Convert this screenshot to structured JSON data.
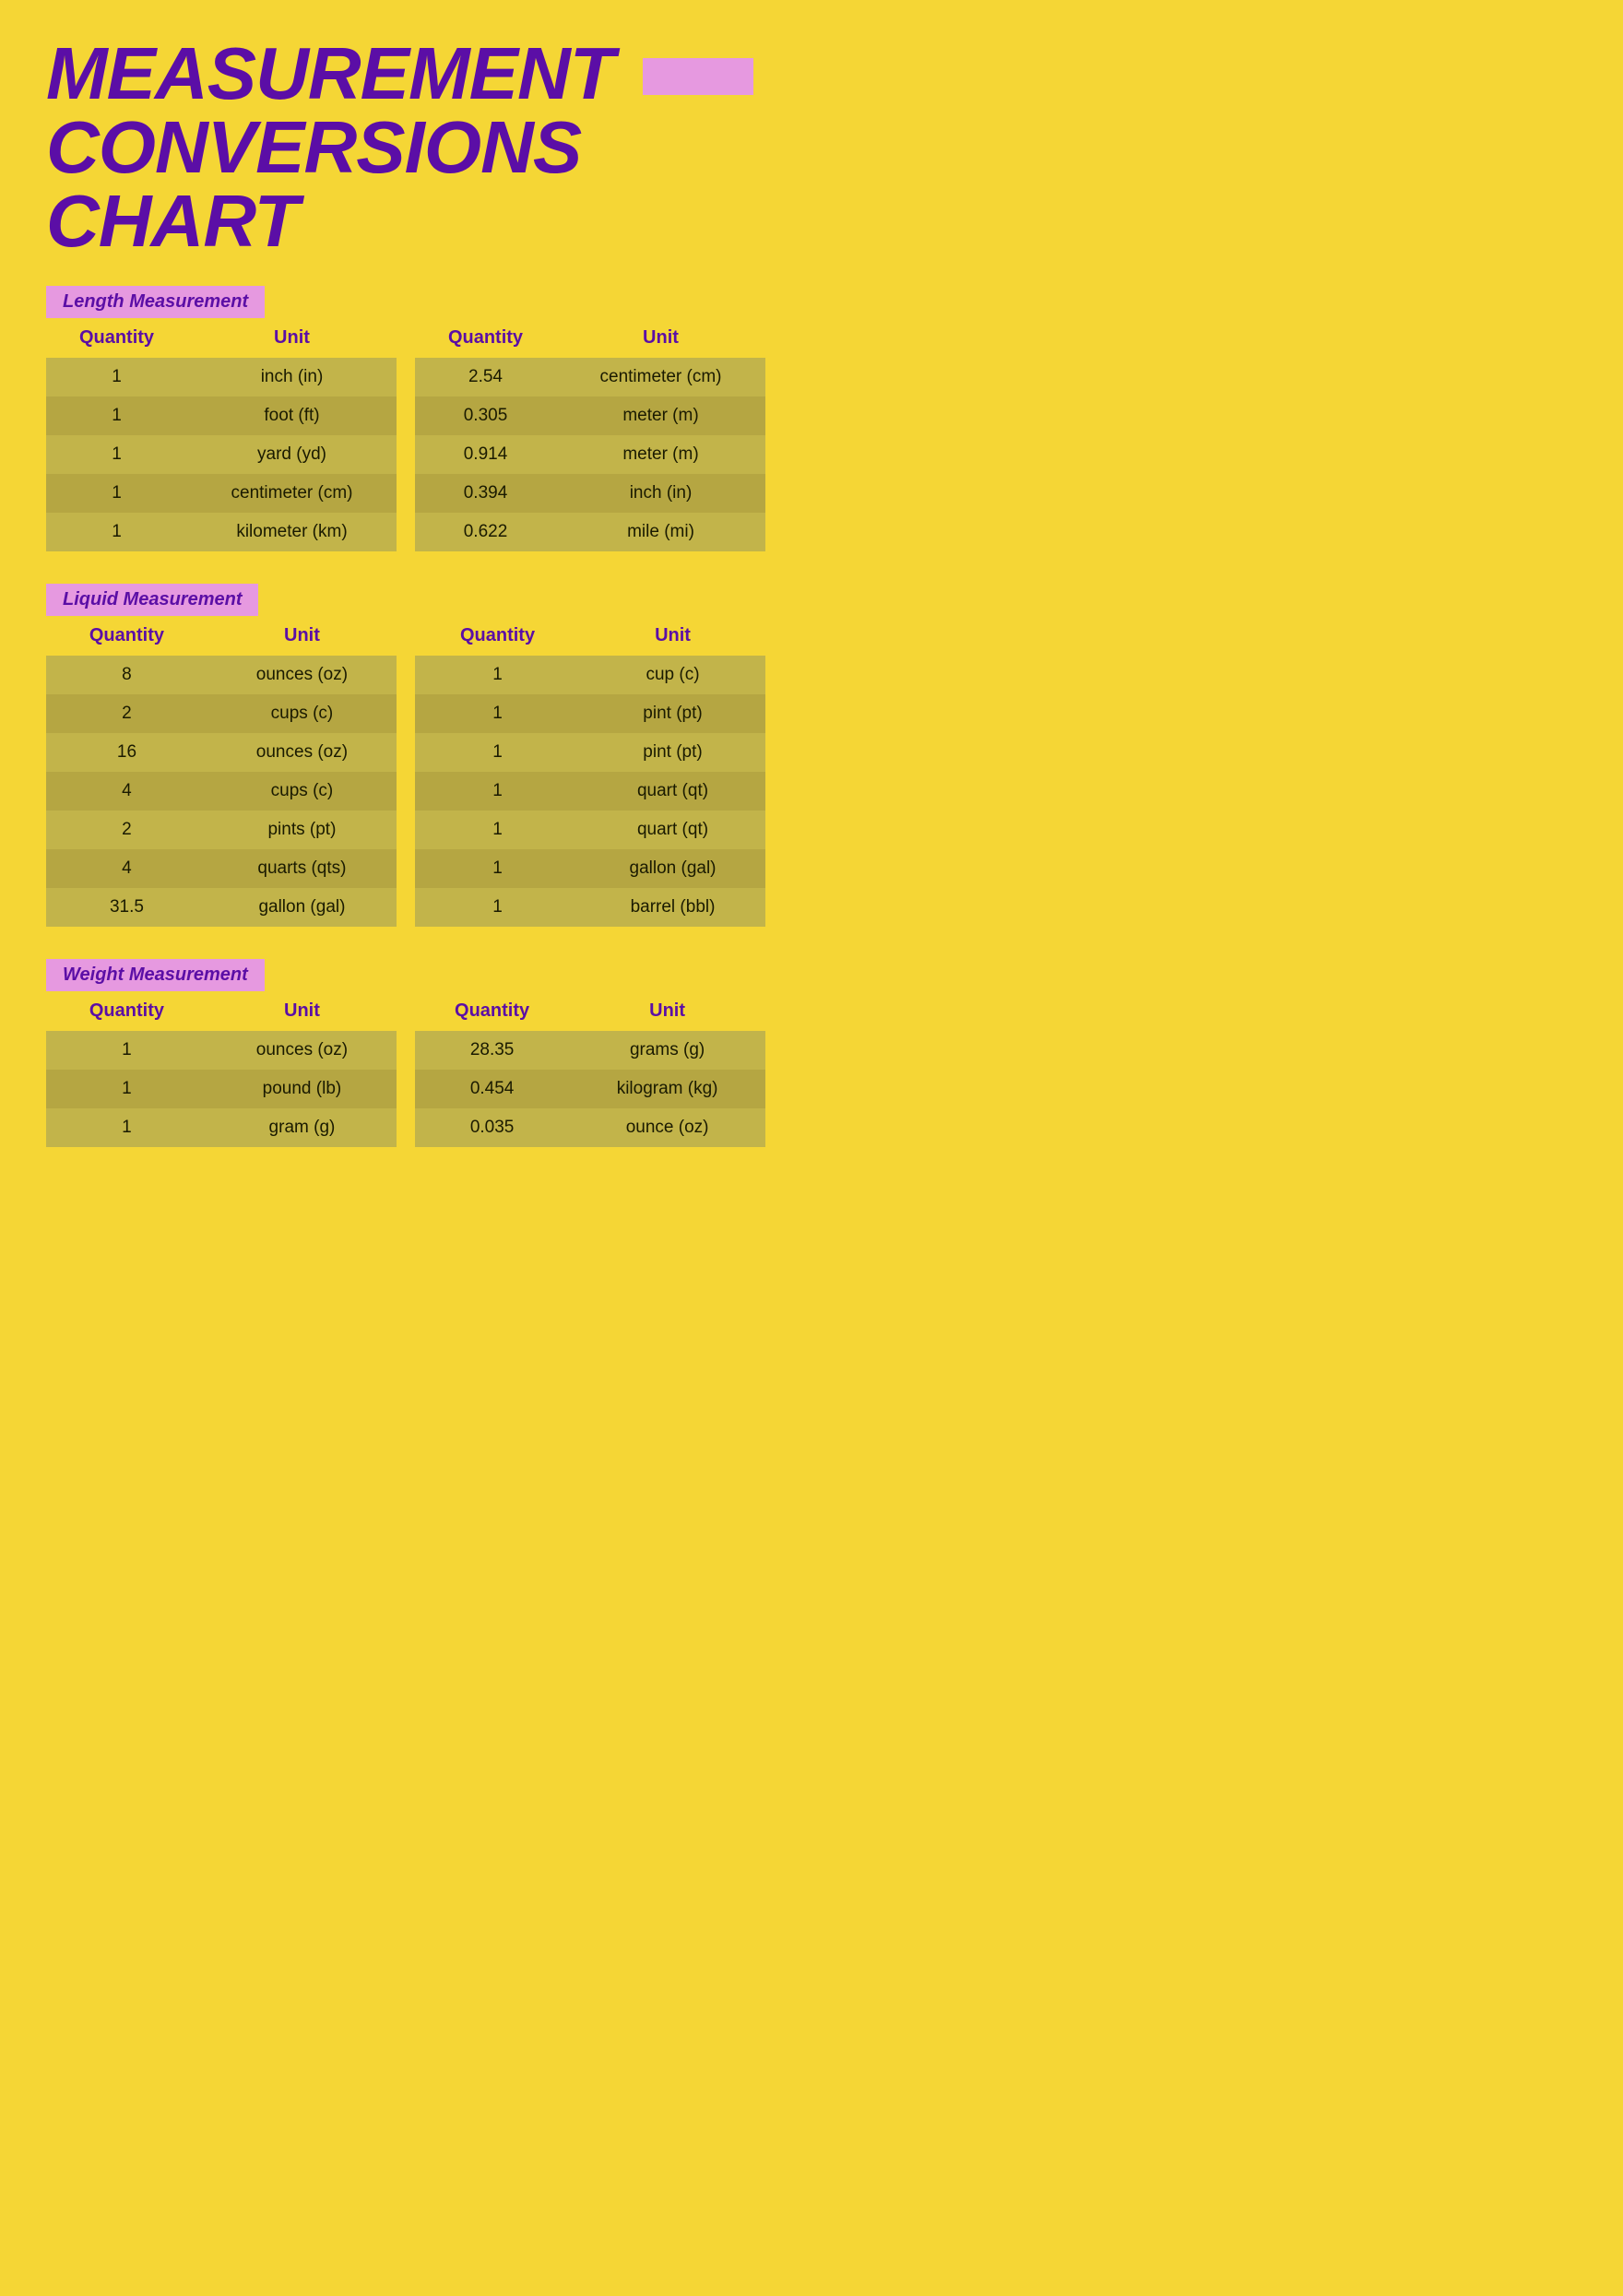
{
  "title": {
    "line1": "MEASUREMENT",
    "line2": "CONVERSIONS CHART"
  },
  "sections": {
    "length": {
      "label": "Length Measurement",
      "left": {
        "headers": [
          "Quantity",
          "Unit"
        ],
        "rows": [
          [
            "1",
            "inch (in)"
          ],
          [
            "1",
            "foot (ft)"
          ],
          [
            "1",
            "yard (yd)"
          ],
          [
            "1",
            "centimeter (cm)"
          ],
          [
            "1",
            "kilometer (km)"
          ]
        ]
      },
      "right": {
        "headers": [
          "Quantity",
          "Unit"
        ],
        "rows": [
          [
            "2.54",
            "centimeter (cm)"
          ],
          [
            "0.305",
            "meter (m)"
          ],
          [
            "0.914",
            "meter (m)"
          ],
          [
            "0.394",
            "inch (in)"
          ],
          [
            "0.622",
            "mile (mi)"
          ]
        ]
      }
    },
    "liquid": {
      "label": "Liquid Measurement",
      "left": {
        "headers": [
          "Quantity",
          "Unit"
        ],
        "rows": [
          [
            "8",
            "ounces (oz)"
          ],
          [
            "2",
            "cups (c)"
          ],
          [
            "16",
            "ounces (oz)"
          ],
          [
            "4",
            "cups (c)"
          ],
          [
            "2",
            "pints (pt)"
          ],
          [
            "4",
            "quarts (qts)"
          ],
          [
            "31.5",
            "gallon (gal)"
          ]
        ]
      },
      "right": {
        "headers": [
          "Quantity",
          "Unit"
        ],
        "rows": [
          [
            "1",
            "cup (c)"
          ],
          [
            "1",
            "pint (pt)"
          ],
          [
            "1",
            "pint (pt)"
          ],
          [
            "1",
            "quart (qt)"
          ],
          [
            "1",
            "quart (qt)"
          ],
          [
            "1",
            "gallon (gal)"
          ],
          [
            "1",
            "barrel (bbl)"
          ]
        ]
      }
    },
    "weight": {
      "label": "Weight Measurement",
      "left": {
        "headers": [
          "Quantity",
          "Unit"
        ],
        "rows": [
          [
            "1",
            "ounces (oz)"
          ],
          [
            "1",
            "pound (lb)"
          ],
          [
            "1",
            "gram (g)"
          ]
        ]
      },
      "right": {
        "headers": [
          "Quantity",
          "Unit"
        ],
        "rows": [
          [
            "28.35",
            "grams (g)"
          ],
          [
            "0.454",
            "kilogram (kg)"
          ],
          [
            "0.035",
            "ounce (oz)"
          ]
        ]
      }
    }
  }
}
